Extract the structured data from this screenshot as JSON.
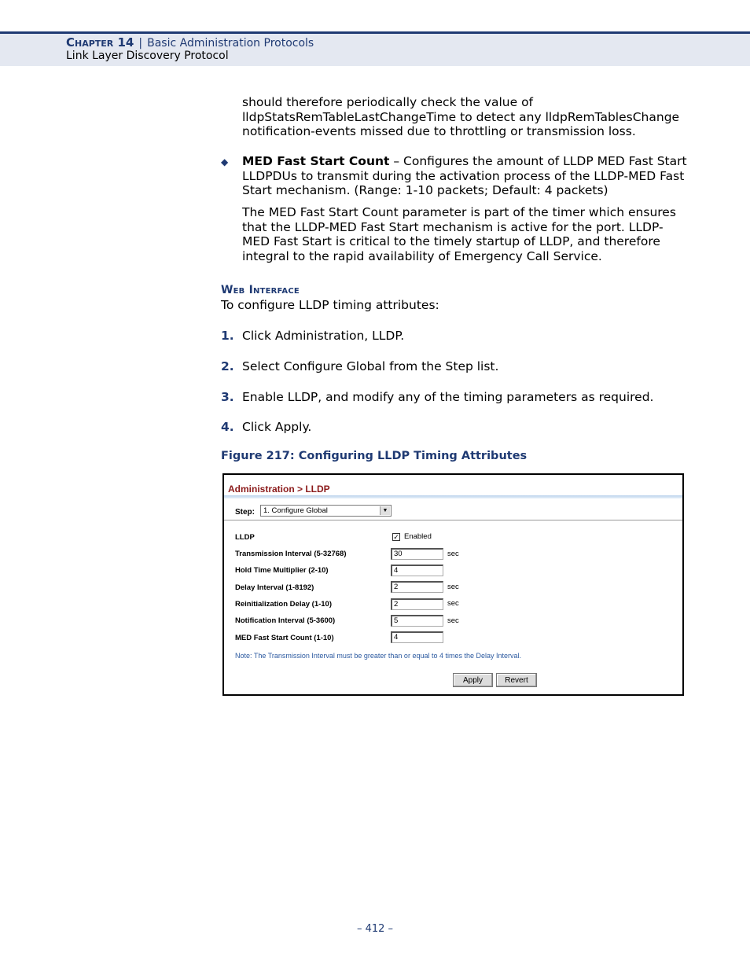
{
  "header": {
    "chapter_label": "Chapter 14",
    "separator": "|",
    "chapter_title": "Basic Administration Protocols",
    "subtitle": "Link Layer Discovery Protocol"
  },
  "body": {
    "continuation": "should therefore periodically check the value of lldpStatsRemTableLastChangeTime to detect any lldpRemTablesChange notification-events missed due to throttling or transmission loss.",
    "bullet_term": "MED Fast Start Count",
    "bullet_text": " – Configures the amount of LLDP MED Fast Start LLDPDUs to transmit during the activation process of the LLDP-MED Fast Start mechanism. (Range: 1-10 packets; Default: 4 packets)",
    "bullet_para": "The MED Fast Start Count parameter is part of the timer which ensures that the LLDP-MED Fast Start mechanism is active for the port. LLDP-MED Fast Start is critical to the timely startup of LLDP, and therefore integral to the rapid availability of Emergency Call Service.",
    "section_title": "Web Interface",
    "intro": "To configure LLDP timing attributes:",
    "steps": [
      {
        "num": "1.",
        "text": "Click Administration, LLDP."
      },
      {
        "num": "2.",
        "text": "Select Configure Global from the Step list."
      },
      {
        "num": "3.",
        "text": "Enable LLDP, and modify any of the timing parameters as required."
      },
      {
        "num": "4.",
        "text": "Click Apply."
      }
    ],
    "figure_caption": "Figure 217:  Configuring LLDP Timing Attributes"
  },
  "figure": {
    "title": "Administration > LLDP",
    "step_label": "Step:",
    "step_value": "1. Configure Global",
    "lldp_label": "LLDP",
    "lldp_enabled": true,
    "lldp_check_mark": "✓",
    "lldp_enabled_label": "Enabled",
    "fields": [
      {
        "label": "Transmission Interval (5-32768)",
        "value": "30",
        "unit": "sec"
      },
      {
        "label": "Hold Time Multiplier (2-10)",
        "value": "4",
        "unit": ""
      },
      {
        "label": "Delay Interval (1-8192)",
        "value": "2",
        "unit": "sec"
      },
      {
        "label": "Reinitialization Delay (1-10)",
        "value": "2",
        "unit": "sec"
      },
      {
        "label": "Notification Interval (5-3600)",
        "value": "5",
        "unit": "sec"
      },
      {
        "label": "MED Fast Start Count (1-10)",
        "value": "4",
        "unit": ""
      }
    ],
    "note": "Note: The Transmission Interval must be greater than or equal to 4 times the Delay Interval.",
    "apply_label": "Apply",
    "revert_label": "Revert"
  },
  "footer": {
    "page_number": "–  412  –"
  }
}
